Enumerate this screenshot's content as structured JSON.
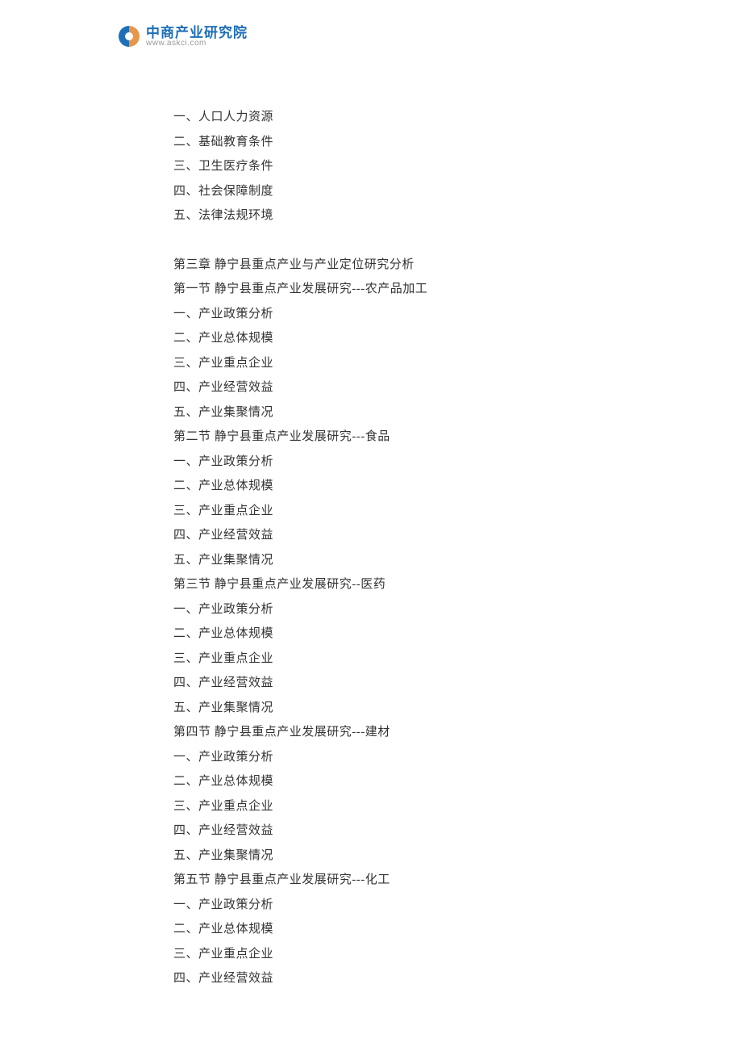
{
  "logo": {
    "main_text": "中商产业研究院",
    "url_text": "www.askci.com"
  },
  "lines": [
    "一、人口人力资源",
    "二、基础教育条件",
    "三、卫生医疗条件",
    "四、社会保障制度",
    "五、法律法规环境",
    "",
    "第三章 静宁县重点产业与产业定位研究分析",
    "第一节 静宁县重点产业发展研究---农产品加工",
    "一、产业政策分析",
    "二、产业总体规模",
    "三、产业重点企业",
    "四、产业经营效益",
    "五、产业集聚情况",
    "第二节 静宁县重点产业发展研究---食品",
    "一、产业政策分析",
    "二、产业总体规模",
    "三、产业重点企业",
    "四、产业经营效益",
    "五、产业集聚情况",
    "第三节 静宁县重点产业发展研究--医药",
    "一、产业政策分析",
    "二、产业总体规模",
    "三、产业重点企业",
    "四、产业经营效益",
    "五、产业集聚情况",
    "第四节 静宁县重点产业发展研究---建材",
    "一、产业政策分析",
    "二、产业总体规模",
    "三、产业重点企业",
    "四、产业经营效益",
    "五、产业集聚情况",
    "第五节 静宁县重点产业发展研究---化工",
    "一、产业政策分析",
    "二、产业总体规模",
    "三、产业重点企业",
    "四、产业经营效益"
  ]
}
